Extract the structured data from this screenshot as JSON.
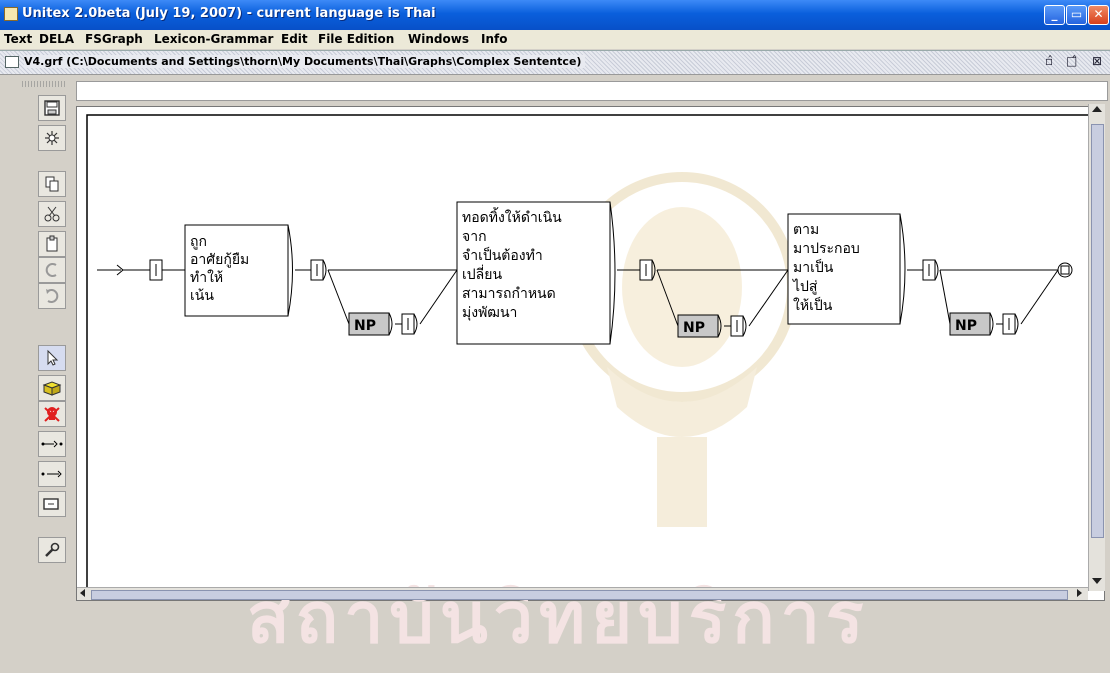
{
  "window": {
    "title": "Unitex 2.0beta (July 19, 2007) - current language is Thai",
    "controls": {
      "minimize": "_",
      "maximize": "▭",
      "close": "✕"
    }
  },
  "menubar": [
    "Text",
    "DELA",
    "FSGraph",
    "Lexicon-Grammar",
    "Edit",
    "File Edition",
    "Windows",
    "Info"
  ],
  "internal_frame": {
    "title": "V4.grf (C:\\Documents and Settings\\thorn\\My Documents\\Thai\\Graphs\\Complex Sententce)",
    "controls": {
      "iconify": "▫̂",
      "maximize": "□̂",
      "close": "⊠"
    }
  },
  "toolbar": [
    "save-icon",
    "compile-icon",
    "copy-icon",
    "cut-icon",
    "paste-icon",
    "redo-icon",
    "undo-icon",
    "select-icon",
    "open-box-icon",
    "delete-icon",
    "link-forward-icon",
    "link-reverse-icon",
    "box-icon",
    "configure-icon"
  ],
  "graph": {
    "box1": [
      "ถูก",
      "อาศัยกู้ยืม",
      "ทำให้",
      "เน้น"
    ],
    "box2": [
      "ทอดทิ้งให้ดำเนิน",
      "จาก",
      "จำเป็นต้องทำ",
      "เปลี่ยน",
      "สามารถกำหนด",
      "มุ่งพัฒนา"
    ],
    "box3": [
      "ตาม",
      "มาประกอบ",
      "มาเป็น",
      "ไปสู่",
      "ให้เป็น"
    ],
    "np_label": "NP"
  },
  "watermark": "สถาบันวิทยบริการ",
  "colors": {
    "titlebar": "#0a5fdc",
    "np_fill": "#c8c8c8",
    "watermark": "#f4e3e3"
  }
}
